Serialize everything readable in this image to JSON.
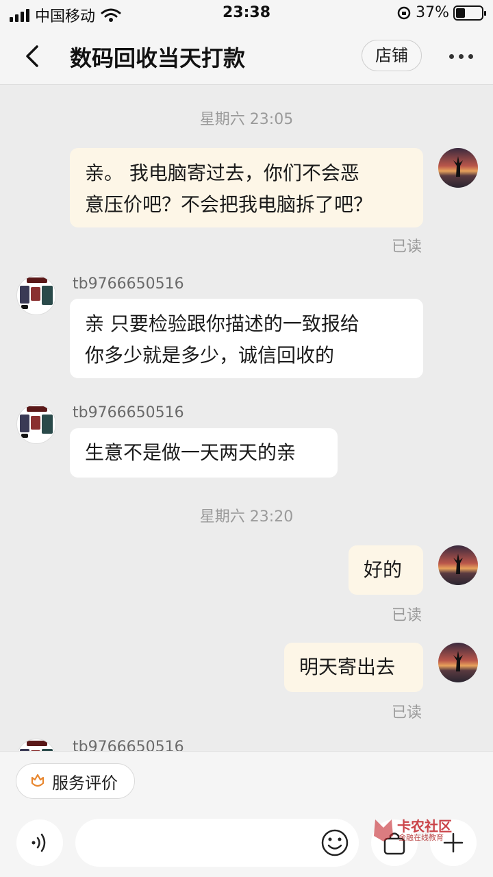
{
  "status": {
    "carrier": "中国移动",
    "time": "23:38",
    "battery_pct": "37%",
    "battery_level": 0.37
  },
  "nav": {
    "title": "数码回收当天打款",
    "shop_label": "店铺"
  },
  "messages": {
    "sep1": "星期六 23:05",
    "m1": "亲。 我电脑寄过去，你们不会恶\n意压价吧？不会把我电脑拆了吧？",
    "m1_read": "已读",
    "sender": "tb9766650516",
    "m2": "亲 只要检验跟你描述的一致报给\n你多少就是多少，诚信回收的",
    "m3": "生意不是做一天两天的亲",
    "sep2": "星期六 23:20",
    "m4": "好的",
    "m4_read": "已读",
    "m5": "明天寄出去",
    "m5_read": "已读"
  },
  "bottom": {
    "service_label": "服务评价",
    "input_placeholder": ""
  },
  "watermark": {
    "brand": "卡农社区",
    "sub": "金融在线教育"
  }
}
